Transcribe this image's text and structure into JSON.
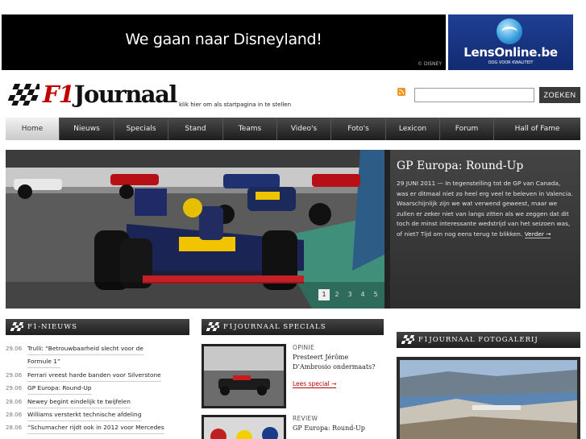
{
  "banners": {
    "main_text": "We gaan naar Disneyland!",
    "main_copyright": "© DISNEY",
    "side_brand": "LensOnline.be",
    "side_tagline": "OOG VOOR KWALITEIT"
  },
  "header": {
    "logo_f1": "F1",
    "logo_rest": "Journaal",
    "startpage_text": "klik hier om als startpagina in te stellen",
    "search_placeholder": "",
    "search_button": "ZOEKEN"
  },
  "nav": [
    "Home",
    "Nieuws",
    "Specials",
    "Stand",
    "Teams",
    "Video's",
    "Foto's",
    "Lexicon",
    "Forum",
    "Hall of Fame"
  ],
  "hero": {
    "title": "GP Europa: Round-Up",
    "text": "29 JUNI 2011 — In tegenstelling tot de GP van Canada, was er ditmaal niet zo heel erg veel te beleven in Valencia. Waarschijnlijk zijn we wat verwend geweest, maar we zullen er zeker niet van langs zitten als we zeggen dat dit toch de minst interessante wedstrijd van het seizoen was, of niet? Tijd om nog eens terug te blikken.",
    "more": "Verder →",
    "pages": [
      "1",
      "2",
      "3",
      "4",
      "5"
    ],
    "active_page": 0
  },
  "sections": {
    "news": "F1-NIEUWS",
    "specials": "F1JOURNAAL SPECIALS",
    "gallery": "F1JOURNAAL FOTOGALERIJ"
  },
  "news": [
    {
      "date": "29.06",
      "title": "Trulli: “Betrouwbaarheid slecht voor de"
    },
    {
      "date": "",
      "title": "Formule 1”"
    },
    {
      "date": "29.06",
      "title": "Ferrari vreest harde banden voor Silverstone"
    },
    {
      "date": "29.06",
      "title": "GP Europa: Round-Up"
    },
    {
      "date": "28.06",
      "title": "Newey begint eindelijk te twijfelen"
    },
    {
      "date": "28.06",
      "title": "Williams versterkt technische afdeling"
    },
    {
      "date": "28.06",
      "title": "“Schumacher rijdt ook in 2012 voor Mercedes"
    }
  ],
  "specials": [
    {
      "category": "OPINIE",
      "title": "Presteert Jérôme D’Ambrosio ondermaats?",
      "link": "Lees special →"
    },
    {
      "category": "REVIEW",
      "title": "GP Europa: Round-Up",
      "link": ""
    }
  ]
}
